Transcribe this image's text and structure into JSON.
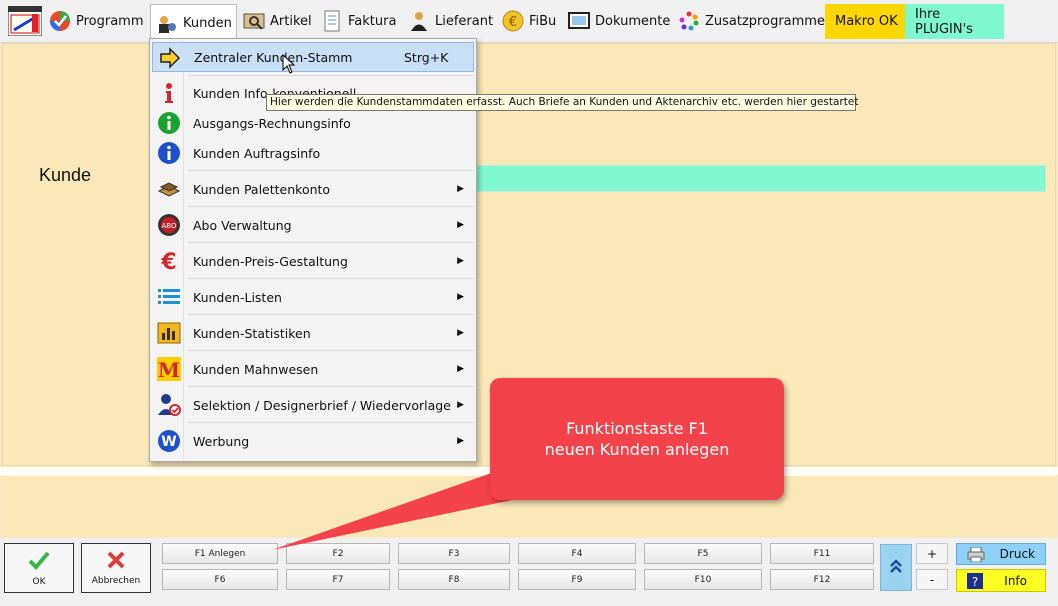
{
  "menubar": {
    "programm": "Programm",
    "kunden": "Kunden",
    "artikel": "Artikel",
    "faktura": "Faktura",
    "lieferant": "Lieferant",
    "fibu": "FiBu",
    "dokumente": "Dokumente",
    "zusatz": "Zusatzprogramme",
    "makro": "Makro OK",
    "plugin": "Ihre PLUGIN's",
    "makro_color": "#ffd700",
    "plugin_color": "#7ff8d0"
  },
  "main": {
    "kunde_label": "Kunde"
  },
  "dropdown": {
    "items": [
      {
        "label": "Zentraler Kunden-Stamm",
        "shortcut": "Strg+K",
        "icon": "arrow-right-icon"
      },
      {
        "label": "Kunden  Info-konventionell",
        "icon": "info-red-icon"
      },
      {
        "label": "Ausgangs-Rechnungsinfo",
        "icon": "info-green-icon"
      },
      {
        "label": "Kunden Auftragsinfo",
        "icon": "info-blue-icon"
      },
      {
        "label": "Kunden Palettenkonto",
        "icon": "pallet-icon"
      },
      {
        "label": "Abo Verwaltung",
        "icon": "abo-icon"
      },
      {
        "label": "Kunden-Preis-Gestaltung",
        "icon": "euro-icon"
      },
      {
        "label": "Kunden-Listen",
        "icon": "list-icon"
      },
      {
        "label": "Kunden-Statistiken",
        "icon": "statistics-icon"
      },
      {
        "label": "Kunden Mahnwesen",
        "icon": "mahnwesen-icon"
      },
      {
        "label": "Selektion / Designerbrief / Wiedervorlage",
        "icon": "selection-icon"
      },
      {
        "label": "Werbung",
        "icon": "werbung-icon"
      }
    ]
  },
  "tooltip": "Hier werden die Kundenstammdaten erfasst. Auch Briefe an Kunden und Aktenarchiv etc. werden hier gestartet",
  "callout": {
    "line1": "Funktionstaste F1",
    "line2": "neuen Kunden anlegen"
  },
  "footer": {
    "ok": "OK",
    "abbrechen": "Abbrechen",
    "fkeys_top": [
      "F1 Anlegen",
      "F2",
      "F3",
      "F4",
      "F5",
      "F11"
    ],
    "fkeys_bottom": [
      "F6",
      "F7",
      "F8",
      "F9",
      "F10",
      "F12"
    ],
    "plus": "+",
    "minus": "-",
    "druck": "Druck",
    "info": "Info"
  }
}
